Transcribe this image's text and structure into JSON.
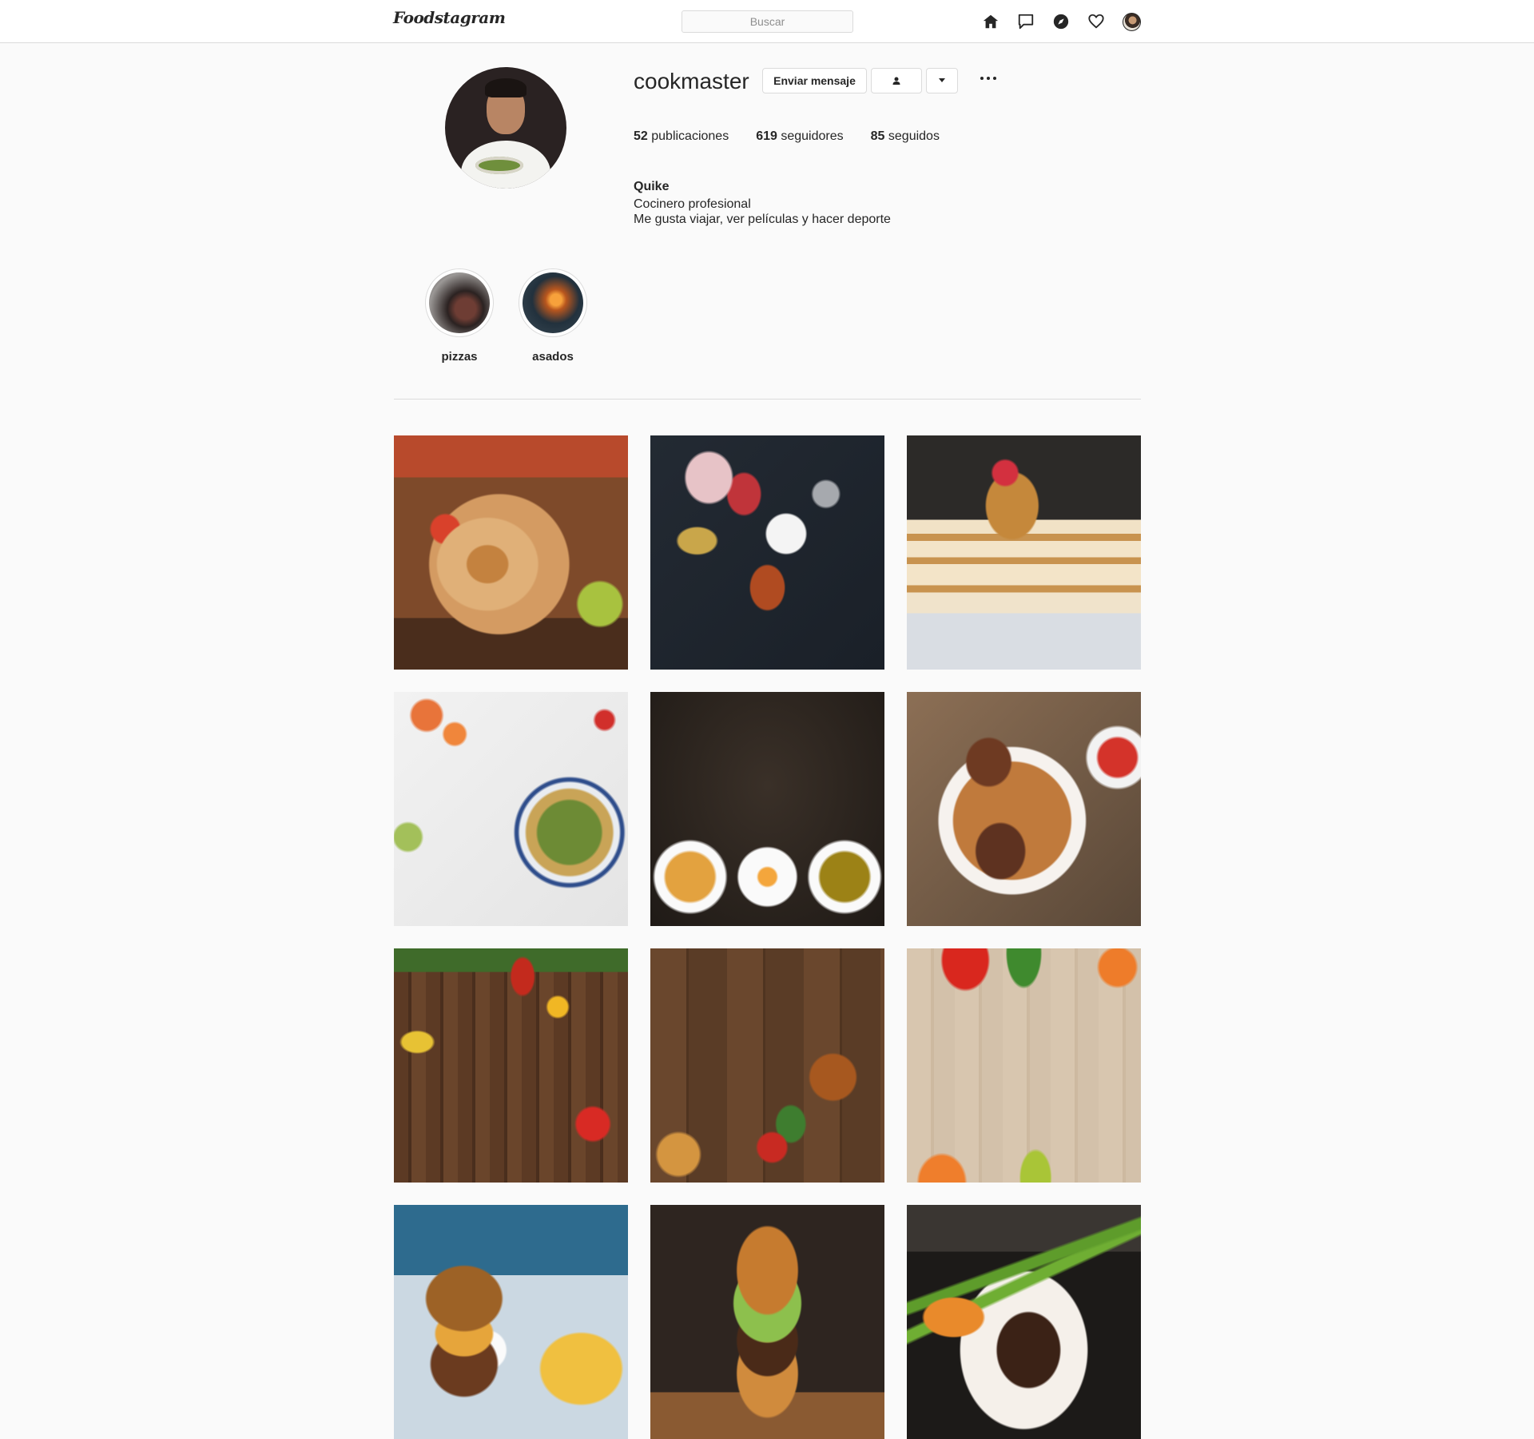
{
  "header": {
    "logo": "Foodstagram",
    "search_placeholder": "Buscar",
    "nav_icons": [
      "home-icon",
      "messages-icon",
      "explore-icon",
      "activity-heart-icon",
      "profile-avatar"
    ]
  },
  "profile": {
    "username": "cookmaster",
    "buttons": {
      "message": "Enviar mensaje",
      "follow_icon": "person-icon",
      "dropdown_icon": "caret-down-icon",
      "options_icon": "more-options-icon"
    },
    "stats": {
      "posts_count": "52",
      "posts_label": "publicaciones",
      "followers_count": "619",
      "followers_label": "seguidores",
      "following_count": "85",
      "following_label": "seguidos"
    },
    "bio": {
      "name": "Quike",
      "line1": "Cocinero profesional",
      "line2": "Me gusta viajar, ver películas y hacer deporte"
    }
  },
  "highlights": [
    {
      "label": "pizzas"
    },
    {
      "label": "asados"
    }
  ],
  "posts": [
    {
      "subject": "burrito"
    },
    {
      "subject": "spices"
    },
    {
      "subject": "pancakes"
    },
    {
      "subject": "vegetable-bowl"
    },
    {
      "subject": "three-plates"
    },
    {
      "subject": "roast-chicken-rice"
    },
    {
      "subject": "vegetables-wood"
    },
    {
      "subject": "burger-wood"
    },
    {
      "subject": "vegetables-light-wood"
    },
    {
      "subject": "burger-fries"
    },
    {
      "subject": "burger-closeup"
    },
    {
      "subject": "steak-asparagus"
    }
  ],
  "colors": {
    "background": "#fafafa",
    "border": "#dbdbdb",
    "text": "#262626",
    "muted": "#8e8e8e"
  }
}
